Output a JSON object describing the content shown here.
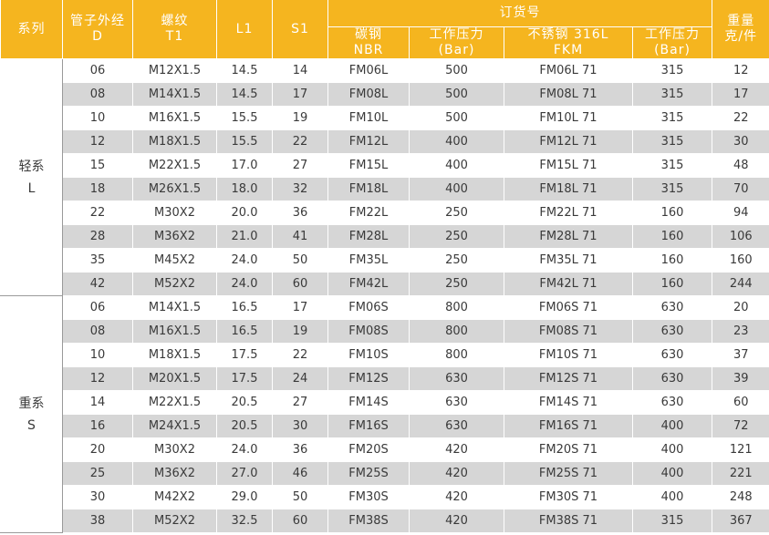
{
  "header": {
    "series": "系列",
    "tube_od": "管子外经",
    "tube_od_sym": "D",
    "thread": "螺纹",
    "thread_sym": "T1",
    "l1": "L1",
    "s1": "S1",
    "order_no": "订货号",
    "carbon_steel": "碳钢",
    "carbon_seal": "NBR",
    "working_pressure_1": "工作压力",
    "bar_1": "(Bar)",
    "stainless": "不锈钢 316L",
    "stainless_seal": "FKM",
    "working_pressure_2": "工作压力",
    "bar_2": "(Bar)",
    "weight": "重量",
    "weight_unit": "克/件"
  },
  "groups": [
    {
      "series_name": "轻系",
      "series_code": "L",
      "rows": [
        [
          "06",
          "M12X1.5",
          "14.5",
          "14",
          "FM06L",
          "500",
          "FM06L 71",
          "315",
          "12"
        ],
        [
          "08",
          "M14X1.5",
          "14.5",
          "17",
          "FM08L",
          "500",
          "FM08L 71",
          "315",
          "17"
        ],
        [
          "10",
          "M16X1.5",
          "15.5",
          "19",
          "FM10L",
          "500",
          "FM10L 71",
          "315",
          "22"
        ],
        [
          "12",
          "M18X1.5",
          "15.5",
          "22",
          "FM12L",
          "400",
          "FM12L 71",
          "315",
          "30"
        ],
        [
          "15",
          "M22X1.5",
          "17.0",
          "27",
          "FM15L",
          "400",
          "FM15L 71",
          "315",
          "48"
        ],
        [
          "18",
          "M26X1.5",
          "18.0",
          "32",
          "FM18L",
          "400",
          "FM18L 71",
          "315",
          "70"
        ],
        [
          "22",
          "M30X2",
          "20.0",
          "36",
          "FM22L",
          "250",
          "FM22L 71",
          "160",
          "94"
        ],
        [
          "28",
          "M36X2",
          "21.0",
          "41",
          "FM28L",
          "250",
          "FM28L 71",
          "160",
          "106"
        ],
        [
          "35",
          "M45X2",
          "24.0",
          "50",
          "FM35L",
          "250",
          "FM35L 71",
          "160",
          "160"
        ],
        [
          "42",
          "M52X2",
          "24.0",
          "60",
          "FM42L",
          "250",
          "FM42L 71",
          "160",
          "244"
        ]
      ]
    },
    {
      "series_name": "重系",
      "series_code": "S",
      "rows": [
        [
          "06",
          "M14X1.5",
          "16.5",
          "17",
          "FM06S",
          "800",
          "FM06S 71",
          "630",
          "20"
        ],
        [
          "08",
          "M16X1.5",
          "16.5",
          "19",
          "FM08S",
          "800",
          "FM08S 71",
          "630",
          "23"
        ],
        [
          "10",
          "M18X1.5",
          "17.5",
          "22",
          "FM10S",
          "800",
          "FM10S 71",
          "630",
          "37"
        ],
        [
          "12",
          "M20X1.5",
          "17.5",
          "24",
          "FM12S",
          "630",
          "FM12S 71",
          "630",
          "39"
        ],
        [
          "14",
          "M22X1.5",
          "20.5",
          "27",
          "FM14S",
          "630",
          "FM14S 71",
          "630",
          "60"
        ],
        [
          "16",
          "M24X1.5",
          "20.5",
          "30",
          "FM16S",
          "630",
          "FM16S 71",
          "400",
          "72"
        ],
        [
          "20",
          "M30X2",
          "24.0",
          "36",
          "FM20S",
          "420",
          "FM20S 71",
          "400",
          "121"
        ],
        [
          "25",
          "M36X2",
          "27.0",
          "46",
          "FM25S",
          "420",
          "FM25S 71",
          "400",
          "221"
        ],
        [
          "30",
          "M42X2",
          "29.0",
          "50",
          "FM30S",
          "420",
          "FM30S 71",
          "400",
          "248"
        ],
        [
          "38",
          "M52X2",
          "32.5",
          "60",
          "FM38S",
          "420",
          "FM38S 71",
          "315",
          "367"
        ]
      ]
    }
  ]
}
